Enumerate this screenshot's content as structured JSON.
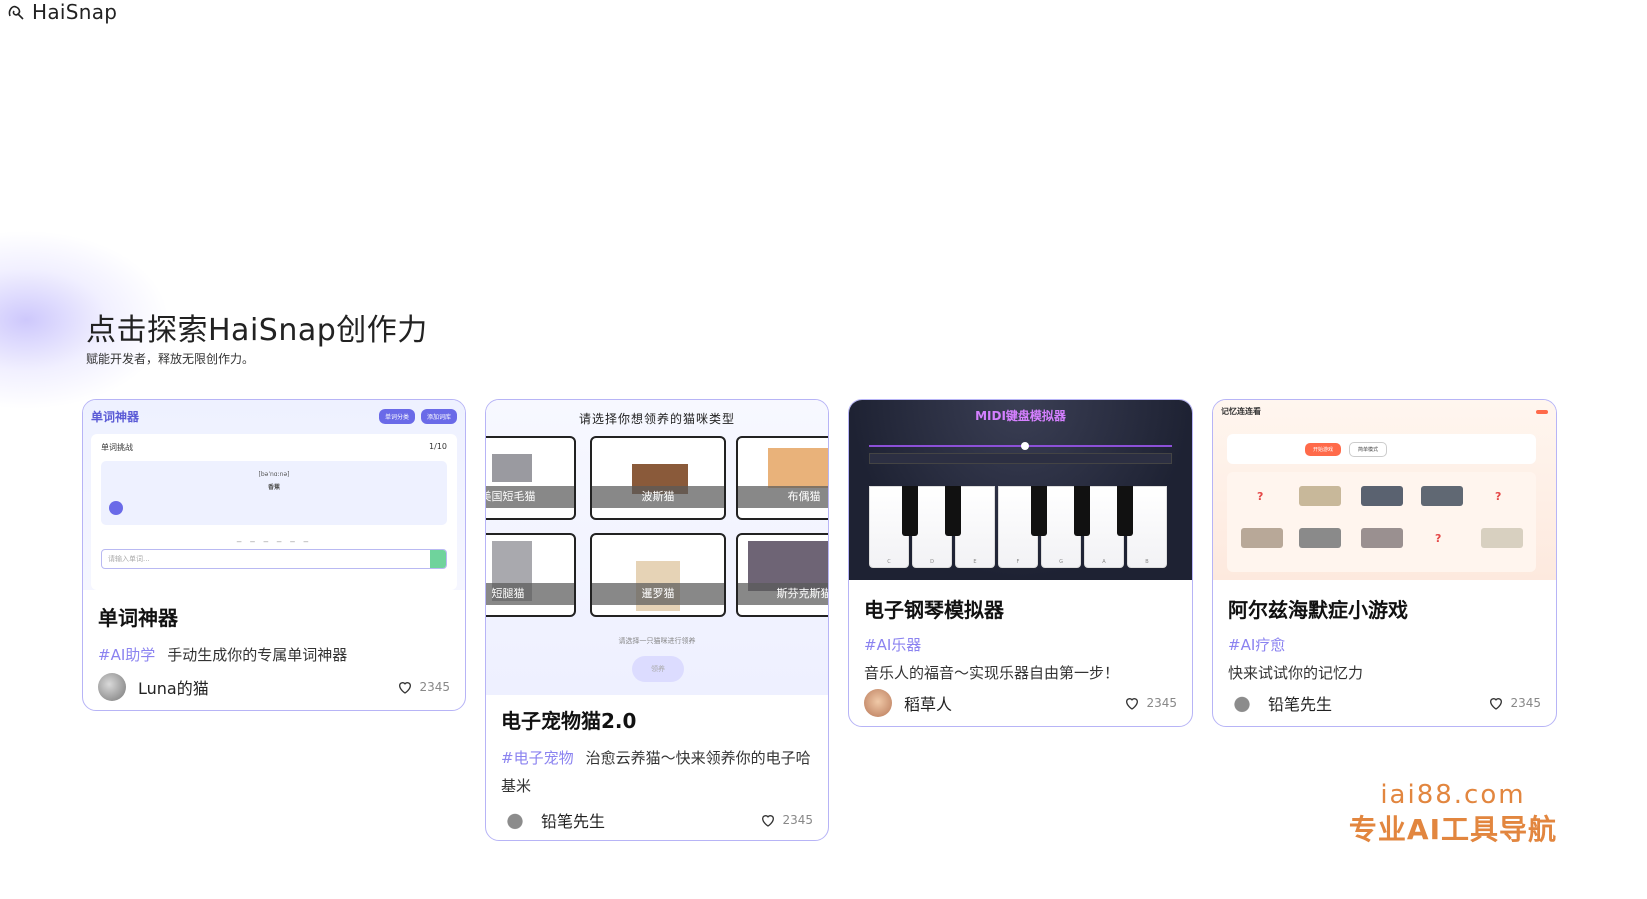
{
  "brand": {
    "name": "HaiSnap"
  },
  "hero": {
    "title": "点击探索HaiSnap创作力",
    "subtitle": "赋能开发者，释放无限创作力。"
  },
  "colors": {
    "accent": "#8b83f0",
    "card_border": "#b7b4f6",
    "watermark": "#e2863f"
  },
  "cards": [
    {
      "title": "单词神器",
      "tag": "#AI助学",
      "desc": "手动生成你的专属单词神器",
      "author": "Luna的猫",
      "likes": "2345",
      "preview": {
        "app_title": "单词神器",
        "btn_a": "单词分类",
        "btn_b": "添加词库",
        "panel_title": "单词挑战",
        "progress": "1/10",
        "phonetic": "[bəˈnɑːnə]",
        "meaning": "香蕉",
        "blanks": "_ _ _ _ _ _",
        "input_placeholder": "请输入单词..."
      }
    },
    {
      "title": "电子宠物猫2.0",
      "tag": "#电子宠物",
      "desc": "治愈云养猫～快来领养你的电子哈基米",
      "author": "铅笔先生",
      "likes": "2345",
      "preview": {
        "question": "请选择你想领养的猫咪类型",
        "cats": [
          "美国短毛猫",
          "波斯猫",
          "布偶猫",
          "短腿猫",
          "暹罗猫",
          "斯芬克斯猫"
        ],
        "hint": "请选择一只猫咪进行领养",
        "button": "领养"
      }
    },
    {
      "title": "电子钢琴模拟器",
      "tag": "#AI乐器",
      "desc": "音乐人的福音～实现乐器自由第一步！",
      "author": "稻草人",
      "likes": "2345",
      "preview": {
        "app_title": "MIDI键盘模拟器",
        "keys": [
          "C",
          "D",
          "E",
          "F",
          "G",
          "A",
          "B"
        ]
      }
    },
    {
      "title": "阿尔兹海默症小游戏",
      "tag": "#AI疗愈",
      "desc": "快来试试你的记忆力",
      "author": "铅笔先生",
      "likes": "2345",
      "preview": {
        "app_title": "记忆连连看",
        "start": "开始游戏",
        "mode": "简单模式"
      }
    }
  ],
  "watermark": {
    "domain": "iai88.com",
    "name": "专业AI工具导航"
  }
}
